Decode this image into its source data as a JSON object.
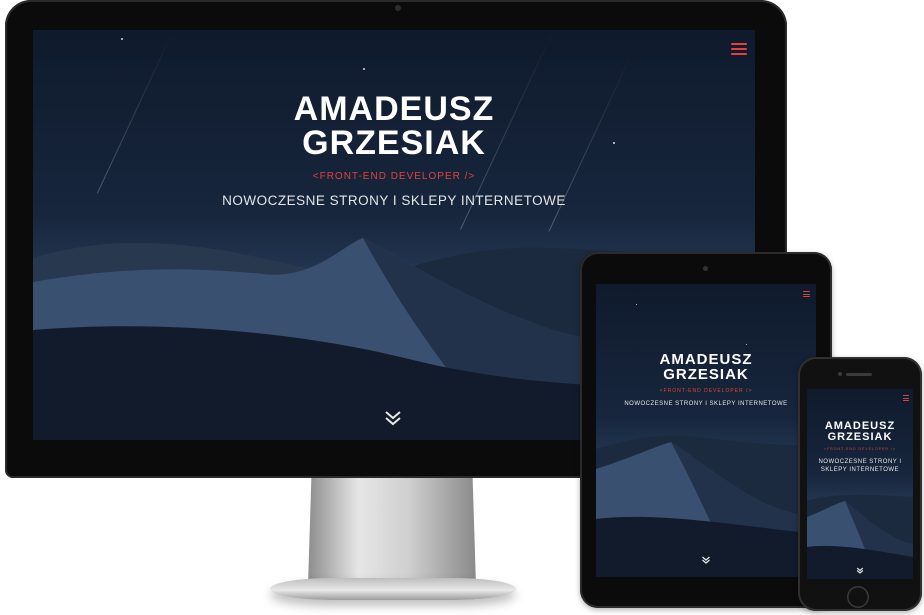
{
  "hero": {
    "title_line1": "AMADEUSZ",
    "title_line2": "GRZESIAK",
    "role": "<FRONT-END DEVELOPER />",
    "tagline": "NOWOCZESNE STRONY I SKLEPY INTERNETOWE"
  },
  "icons": {
    "menu": "hamburger-menu-icon",
    "scroll": "double-chevron-down-icon"
  },
  "colors": {
    "accent": "#e2413f",
    "sky": "#0f1a2c",
    "text": "#ffffff"
  }
}
